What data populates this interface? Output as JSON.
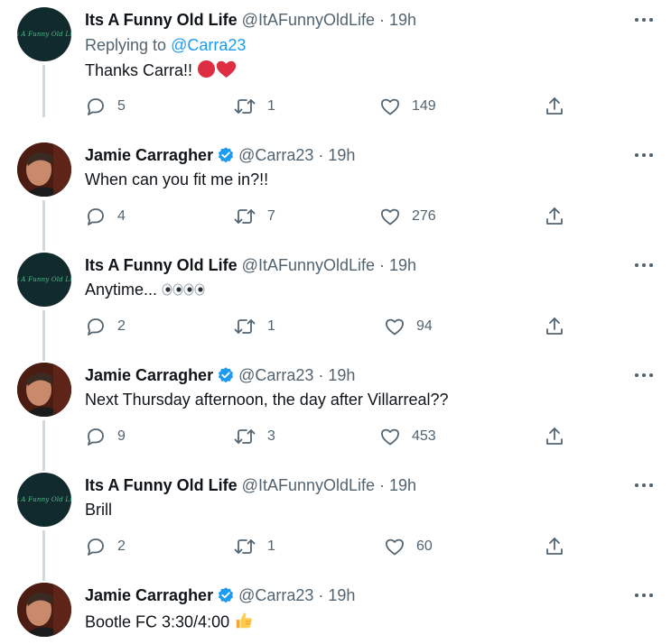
{
  "tweets": [
    {
      "author": "Its A Funny Old Life",
      "handle": "@ItAFunnyOldLife",
      "separator": "·",
      "time": "19h",
      "verified": false,
      "avatar_logo_text": "Its A Funny Old Life",
      "replying_prefix": "Replying to",
      "replying_mention": "@Carra23",
      "text": "Thanks Carra!!",
      "emoji": [
        "red-circle",
        "red-heart"
      ],
      "replies": "5",
      "retweets": "1",
      "likes": "149"
    },
    {
      "author": "Jamie Carragher",
      "handle": "@Carra23",
      "separator": "·",
      "time": "19h",
      "verified": true,
      "text": "When can you fit me in?!!",
      "replies": "4",
      "retweets": "7",
      "likes": "276"
    },
    {
      "author": "Its A Funny Old Life",
      "handle": "@ItAFunnyOldLife",
      "separator": "·",
      "time": "19h",
      "verified": false,
      "avatar_logo_text": "Its A Funny Old Life",
      "text": "Anytime...",
      "emoji": [
        "eyes",
        "eyes"
      ],
      "replies": "2",
      "retweets": "1",
      "likes": "94"
    },
    {
      "author": "Jamie Carragher",
      "handle": "@Carra23",
      "separator": "·",
      "time": "19h",
      "verified": true,
      "text": "Next Thursday afternoon, the day after Villarreal??",
      "replies": "9",
      "retweets": "3",
      "likes": "453"
    },
    {
      "author": "Its A Funny Old Life",
      "handle": "@ItAFunnyOldLife",
      "separator": "·",
      "time": "19h",
      "verified": false,
      "avatar_logo_text": "Its A Funny Old Life",
      "text": "Brill",
      "replies": "2",
      "retweets": "1",
      "likes": "60"
    },
    {
      "author": "Jamie Carragher",
      "handle": "@Carra23",
      "separator": "·",
      "time": "19h",
      "verified": true,
      "text": "Bootle FC 3:30/4:00",
      "emoji": [
        "thumbs-up"
      ]
    }
  ],
  "colors": {
    "accent": "#1d9bf0",
    "secondary_text": "#536471",
    "primary_text": "#0f1419",
    "thread_line": "#cfd9de"
  },
  "icons": {
    "reply": "comment-bubble-icon",
    "retweet": "retweet-icon",
    "like": "heart-outline-icon",
    "share": "share-upload-icon",
    "more": "more-dots-icon",
    "verified": "verified-badge-icon"
  }
}
